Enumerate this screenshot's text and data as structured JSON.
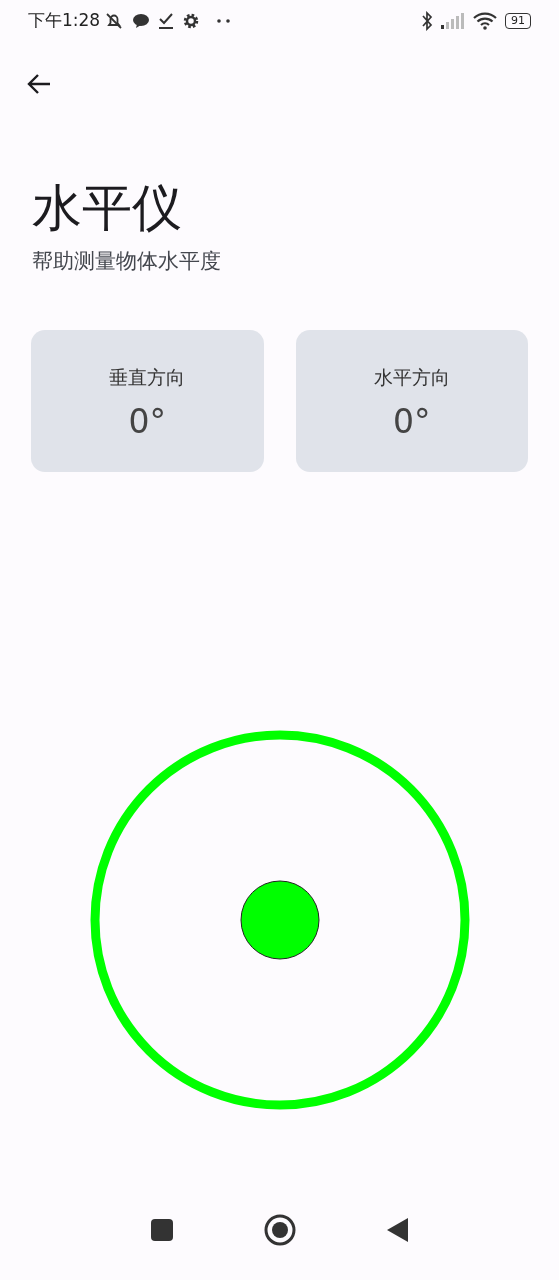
{
  "status_bar": {
    "time": "下午1:28",
    "battery": "91"
  },
  "header": {
    "title": "水平仪",
    "subtitle": "帮助测量物体水平度"
  },
  "readings": [
    {
      "label": "垂直方向",
      "value": "0°"
    },
    {
      "label": "水平方向",
      "value": "0°"
    }
  ]
}
